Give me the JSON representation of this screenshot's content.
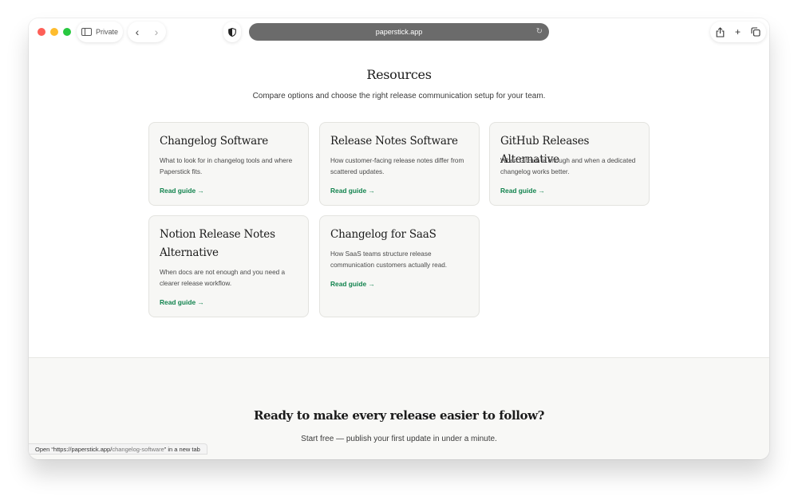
{
  "browser": {
    "private_label": "Private",
    "url": "paperstick.app",
    "status": {
      "prefix": "Open “https://paperstick.app/",
      "path": "changelog-software",
      "suffix": "” in a new tab"
    }
  },
  "resources": {
    "title": "Resources",
    "subtitle": "Compare options and choose the right release communication setup for your team.",
    "cards": [
      {
        "title": "Changelog Software",
        "description": "What to look for in changelog tools and where Paperstick fits.",
        "link": "Read guide →"
      },
      {
        "title": "Release Notes Software",
        "description": "How customer-facing release notes differ from scattered updates.",
        "link": "Read guide →"
      },
      {
        "title": "GitHub Releases Alternative",
        "description": "When GitHub is enough and when a dedicated changelog works better.",
        "link": "Read guide →"
      },
      {
        "title": "Notion Release Notes Alternative",
        "description": "When docs are not enough and you need a clearer release workflow.",
        "link": "Read guide →"
      },
      {
        "title": "Changelog for SaaS",
        "description": "How SaaS teams structure release communication customers actually read.",
        "link": "Read guide →"
      }
    ]
  },
  "cta": {
    "title": "Ready to make every release easier to follow?",
    "subtitle": "Start free — publish your first update in under a minute."
  },
  "colors": {
    "accent_link": "#13844f",
    "url_bar": "#6b6b6b",
    "card_bg": "#f7f7f5"
  }
}
